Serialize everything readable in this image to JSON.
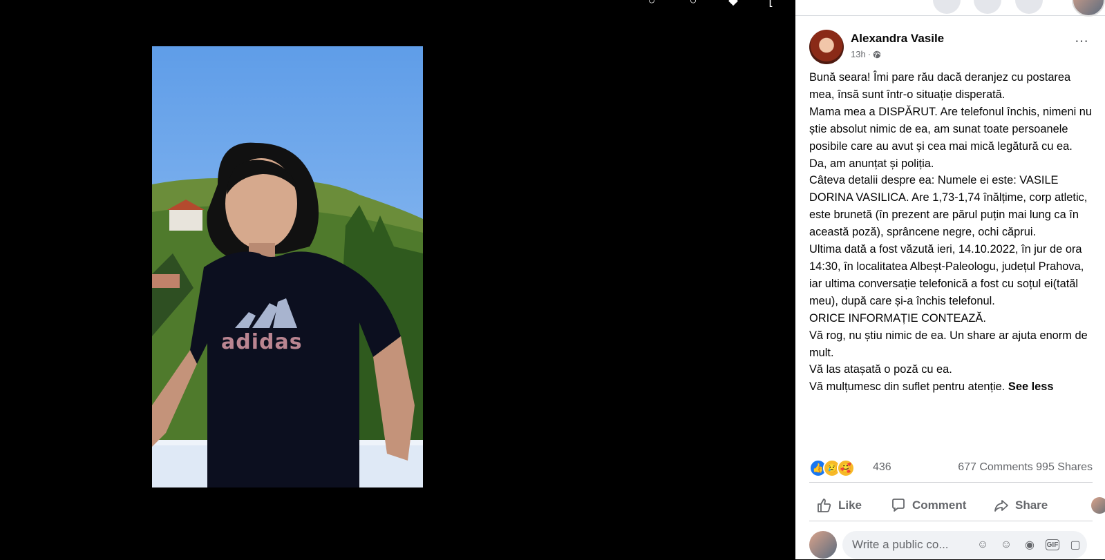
{
  "viewer": {
    "photo_alt": "",
    "tools": [
      "search-icon",
      "zoom-icon",
      "tag-icon",
      "fullscreen-icon"
    ]
  },
  "post": {
    "author": "Alexandra Vasile",
    "time": "13h",
    "dot": "·",
    "text": "Bună seara! Îmi pare rău dacă deranjez cu postarea mea, însă sunt într-o situație disperată.\nMama mea a DISPĂRUT. Are telefonul închis, nimeni nu știe absolut nimic de ea, am sunat toate persoanele posibile care au avut și cea mai mică legătură cu ea. Da, am anunțat și poliția.\nCâteva detalii despre ea: Numele ei este: VASILE DORINA VASILICA. Are 1,73-1,74 înălțime, corp atletic, este brunetă (în prezent are părul puțin mai lung ca în această poză), sprâncene negre, ochi căprui.\nUltima dată a fost văzută ieri, 14.10.2022, în jur de ora 14:30, în localitatea Albeșt-Paleologu, județul Prahova, iar ultima conversație telefonică a fost cu soțul ei(tatăl meu), după care și-a închis telefonul.\nORICE INFORMAȚIE CONTEAZĂ.\nVă rog, nu știu nimic de ea. Un share ar ajuta enorm de mult.\nVă las atașată o poză cu ea.\nVă mulțumesc din suflet pentru atenție. ",
    "see_less": "See less",
    "reaction_count": "436",
    "comments": "677 Comments",
    "shares": "995 Shares"
  },
  "actions": {
    "like": "Like",
    "comment": "Comment",
    "share": "Share"
  },
  "comment_box": {
    "placeholder": "Write a public co..."
  },
  "colors": {
    "accent": "#1877f2",
    "muted_text": "#65676b",
    "divider": "#ced0d4"
  }
}
